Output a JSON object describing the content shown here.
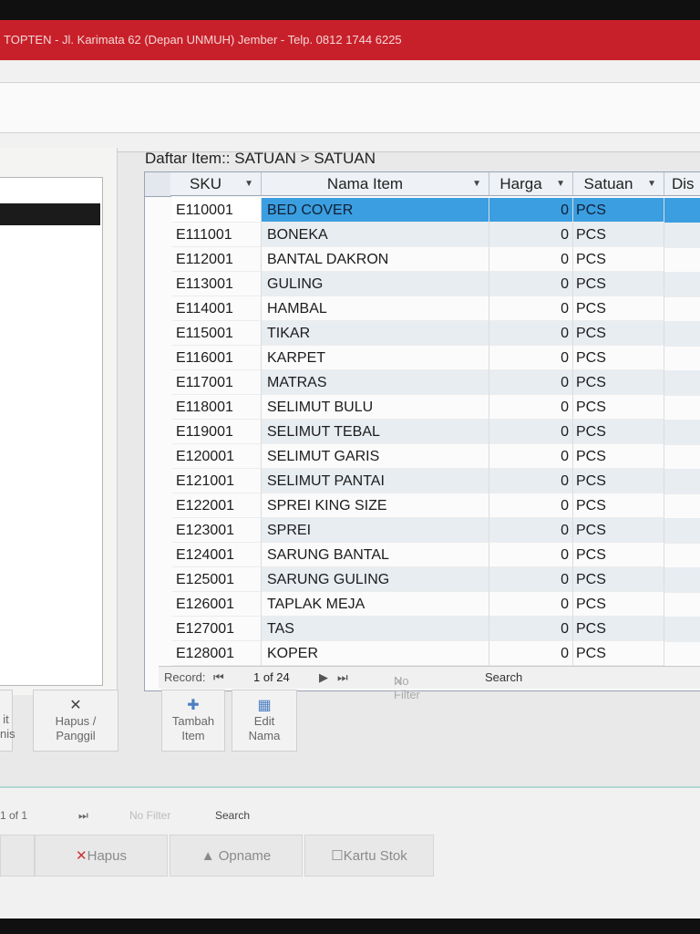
{
  "window": {
    "title": "TOPTEN - Jl. Karimata 62 (Depan UNMUH) Jember - Telp. 0812 1744 6225"
  },
  "list": {
    "title": "Daftar Item:: SATUAN > SATUAN"
  },
  "columns": {
    "sku": "SKU",
    "nama": "Nama Item",
    "harga": "Harga",
    "satuan": "Satuan",
    "disc": "Dis"
  },
  "rows": [
    {
      "sku": "E110001",
      "nama": "BED COVER",
      "harga": "0",
      "satuan": "PCS"
    },
    {
      "sku": "E111001",
      "nama": "BONEKA",
      "harga": "0",
      "satuan": "PCS"
    },
    {
      "sku": "E112001",
      "nama": "BANTAL DAKRON",
      "harga": "0",
      "satuan": "PCS"
    },
    {
      "sku": "E113001",
      "nama": "GULING",
      "harga": "0",
      "satuan": "PCS"
    },
    {
      "sku": "E114001",
      "nama": "HAMBAL",
      "harga": "0",
      "satuan": "PCS"
    },
    {
      "sku": "E115001",
      "nama": "TIKAR",
      "harga": "0",
      "satuan": "PCS"
    },
    {
      "sku": "E116001",
      "nama": "KARPET",
      "harga": "0",
      "satuan": "PCS"
    },
    {
      "sku": "E117001",
      "nama": "MATRAS",
      "harga": "0",
      "satuan": "PCS"
    },
    {
      "sku": "E118001",
      "nama": "SELIMUT BULU",
      "harga": "0",
      "satuan": "PCS"
    },
    {
      "sku": "E119001",
      "nama": "SELIMUT TEBAL",
      "harga": "0",
      "satuan": "PCS"
    },
    {
      "sku": "E120001",
      "nama": "SELIMUT GARIS",
      "harga": "0",
      "satuan": "PCS"
    },
    {
      "sku": "E121001",
      "nama": "SELIMUT PANTAI",
      "harga": "0",
      "satuan": "PCS"
    },
    {
      "sku": "E122001",
      "nama": "SPREI KING SIZE",
      "harga": "0",
      "satuan": "PCS"
    },
    {
      "sku": "E123001",
      "nama": "SPREI",
      "harga": "0",
      "satuan": "PCS"
    },
    {
      "sku": "E124001",
      "nama": "SARUNG BANTAL",
      "harga": "0",
      "satuan": "PCS"
    },
    {
      "sku": "E125001",
      "nama": "SARUNG GULING",
      "harga": "0",
      "satuan": "PCS"
    },
    {
      "sku": "E126001",
      "nama": "TAPLAK MEJA",
      "harga": "0",
      "satuan": "PCS"
    },
    {
      "sku": "E127001",
      "nama": "TAS",
      "harga": "0",
      "satuan": "PCS"
    },
    {
      "sku": "E128001",
      "nama": "KOPER",
      "harga": "0",
      "satuan": "PCS"
    }
  ],
  "navigator": {
    "record_label": "Record:",
    "position": "1 of 24",
    "no_filter": "No Filter",
    "search": "Search"
  },
  "buttons": {
    "left_partial_top": "it",
    "left_partial_bottom": "nis",
    "hapus_panggil_1": "Hapus /",
    "hapus_panggil_2": "Panggil",
    "tambah_1": "Tambah",
    "tambah_2": "Item",
    "edit_1": "Edit",
    "edit_2": "Nama"
  },
  "bottom_nav": {
    "position": "1 of 1",
    "no_filter": "No Filter",
    "search": "Search"
  },
  "bottom_buttons": {
    "hapus": "Hapus",
    "opname": "Opname",
    "kartu_stok": "Kartu Stok"
  }
}
